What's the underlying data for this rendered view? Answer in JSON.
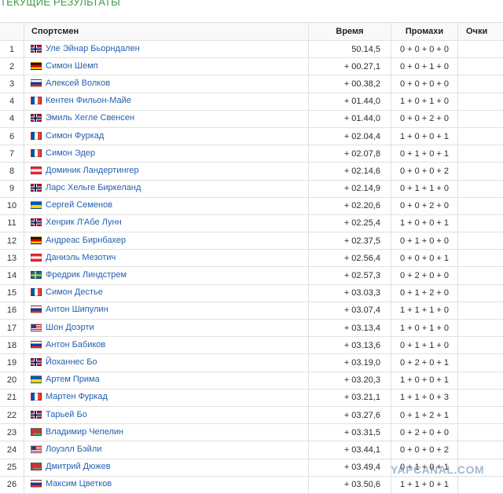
{
  "heading": "ТЕКУЩИЕ РЕЗУЛЬТАТЫ",
  "columns": {
    "place": "",
    "athlete": "Спортсмен",
    "time": "Время",
    "misses": "Промахи",
    "points": "Очки"
  },
  "rows": [
    {
      "place": "1",
      "country": "NOR",
      "name": "Уле Эйнар Бьорндален",
      "time": "50.14,5",
      "misses": "0 + 0 + 0 + 0",
      "points": ""
    },
    {
      "place": "2",
      "country": "GER",
      "name": "Симон Шемп",
      "time": "+ 00.27,1",
      "misses": "0 + 0 + 1 + 0",
      "points": ""
    },
    {
      "place": "3",
      "country": "RUS",
      "name": "Алексей Волков",
      "time": "+ 00.38,2",
      "misses": "0 + 0 + 0 + 0",
      "points": ""
    },
    {
      "place": "4",
      "country": "FRA",
      "name": "Кентен Фильон-Майе",
      "time": "+ 01.44,0",
      "misses": "1 + 0 + 1 + 0",
      "points": ""
    },
    {
      "place": "4",
      "country": "NOR",
      "name": "Эмиль Хегле Свенсен",
      "time": "+ 01.44,0",
      "misses": "0 + 0 + 2 + 0",
      "points": ""
    },
    {
      "place": "6",
      "country": "FRA",
      "name": "Симон Фуркад",
      "time": "+ 02.04,4",
      "misses": "1 + 0 + 0 + 1",
      "points": ""
    },
    {
      "place": "7",
      "country": "FRA",
      "name": "Симон Эдер",
      "time": "+ 02.07,8",
      "misses": "0 + 1 + 0 + 1",
      "points": ""
    },
    {
      "place": "8",
      "country": "AUT",
      "name": "Доминик Ландертингер",
      "time": "+ 02.14,6",
      "misses": "0 + 0 + 0 + 2",
      "points": ""
    },
    {
      "place": "9",
      "country": "NOR",
      "name": "Ларс Хельге Биркеланд",
      "time": "+ 02.14,9",
      "misses": "0 + 1 + 1 + 0",
      "points": ""
    },
    {
      "place": "10",
      "country": "UKR",
      "name": "Сергей Семенов",
      "time": "+ 02.20,6",
      "misses": "0 + 0 + 2 + 0",
      "points": ""
    },
    {
      "place": "11",
      "country": "NOR",
      "name": "Хенрик Л'Абе Лунн",
      "time": "+ 02.25,4",
      "misses": "1 + 0 + 0 + 1",
      "points": ""
    },
    {
      "place": "12",
      "country": "GER",
      "name": "Андреас Бирнбахер",
      "time": "+ 02.37,5",
      "misses": "0 + 1 + 0 + 0",
      "points": ""
    },
    {
      "place": "13",
      "country": "AUT",
      "name": "Даниэль Мезотич",
      "time": "+ 02.56,4",
      "misses": "0 + 0 + 0 + 1",
      "points": ""
    },
    {
      "place": "14",
      "country": "SWE",
      "name": "Фредрик Линдстрем",
      "time": "+ 02.57,3",
      "misses": "0 + 2 + 0 + 0",
      "points": ""
    },
    {
      "place": "15",
      "country": "FRA",
      "name": "Симон Дестье",
      "time": "+ 03.03,3",
      "misses": "0 + 1 + 2 + 0",
      "points": ""
    },
    {
      "place": "16",
      "country": "RUS",
      "name": "Антон Шипулин",
      "time": "+ 03.07,4",
      "misses": "1 + 1 + 1 + 0",
      "points": ""
    },
    {
      "place": "17",
      "country": "USA",
      "name": "Шон Доэрти",
      "time": "+ 03.13,4",
      "misses": "1 + 0 + 1 + 0",
      "points": ""
    },
    {
      "place": "18",
      "country": "RUS",
      "name": "Антон Бабиков",
      "time": "+ 03.13,6",
      "misses": "0 + 1 + 1 + 0",
      "points": ""
    },
    {
      "place": "19",
      "country": "NOR",
      "name": "Йоханнес Бо",
      "time": "+ 03.19,0",
      "misses": "0 + 2 + 0 + 1",
      "points": ""
    },
    {
      "place": "20",
      "country": "UKR",
      "name": "Артем Прима",
      "time": "+ 03.20,3",
      "misses": "1 + 0 + 0 + 1",
      "points": ""
    },
    {
      "place": "21",
      "country": "FRA",
      "name": "Мартен Фуркад",
      "time": "+ 03.21,1",
      "misses": "1 + 1 + 0 + 3",
      "points": ""
    },
    {
      "place": "22",
      "country": "NOR",
      "name": "Тарьей Бо",
      "time": "+ 03.27,6",
      "misses": "0 + 1 + 2 + 1",
      "points": ""
    },
    {
      "place": "23",
      "country": "BLR",
      "name": "Владимир Чепелин",
      "time": "+ 03.31,5",
      "misses": "0 + 2 + 0 + 0",
      "points": ""
    },
    {
      "place": "24",
      "country": "USA",
      "name": "Лоуэлл Бэйли",
      "time": "+ 03.44,1",
      "misses": "0 + 0 + 0 + 2",
      "points": ""
    },
    {
      "place": "25",
      "country": "BLR",
      "name": "Дмитрий Дюжев",
      "time": "+ 03.49,4",
      "misses": "0 + 1 + 0 + 1",
      "points": ""
    },
    {
      "place": "26",
      "country": "RUS",
      "name": "Максим Цветков",
      "time": "+ 03.50,6",
      "misses": "1 + 1 + 0 + 1",
      "points": ""
    }
  ],
  "watermark": "YAPCANAL.COM"
}
